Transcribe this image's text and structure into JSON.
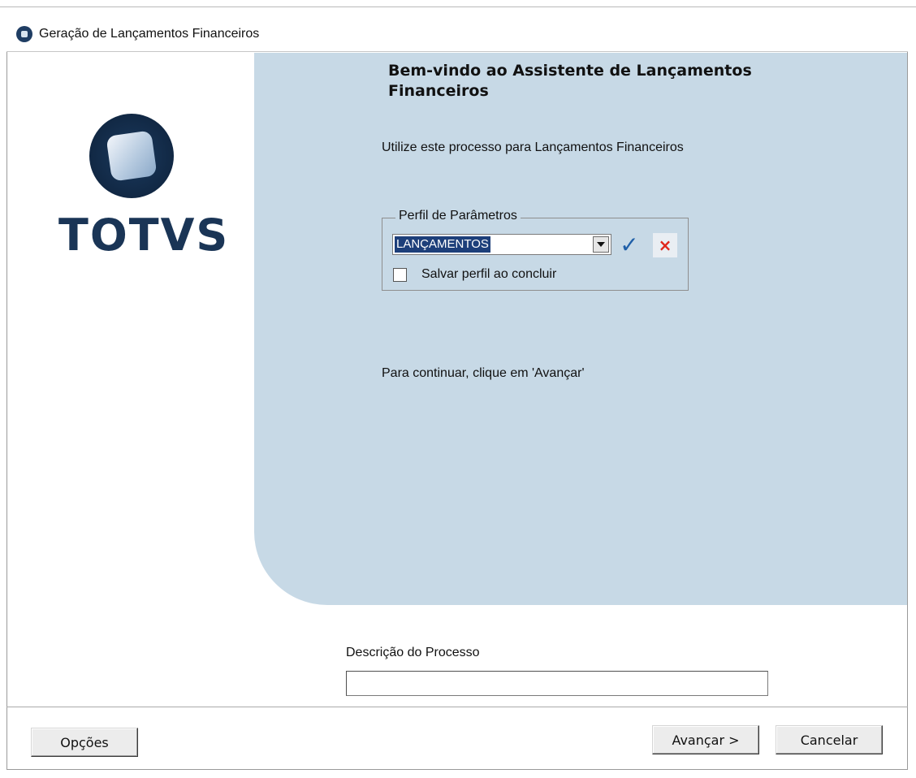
{
  "window": {
    "title": "Geração de Lançamentos Financeiros"
  },
  "logo": {
    "text": "TOTVS"
  },
  "welcome": {
    "title": "Bem-vindo ao Assistente de Lançamentos Financeiros",
    "intro": "Utilize este processo para Lançamentos Financeiros",
    "continue_hint": "Para continuar, clique em 'Avançar'"
  },
  "profile": {
    "group_label": "Perfil de Parâmetros",
    "selected_value": "LANÇAMENTOS",
    "confirm_icon": "check-icon",
    "clear_icon": "close-icon",
    "save_checkbox_label": "Salvar perfil ao concluir",
    "save_checked": false
  },
  "description": {
    "label": "Descrição do Processo",
    "value": ""
  },
  "footer": {
    "options_label": "Opções",
    "next_label": "Avançar >",
    "cancel_label": "Cancelar"
  },
  "colors": {
    "panel": "#c7d9e6",
    "logo_dark": "#1a3556",
    "selection": "#1d3f7a"
  }
}
